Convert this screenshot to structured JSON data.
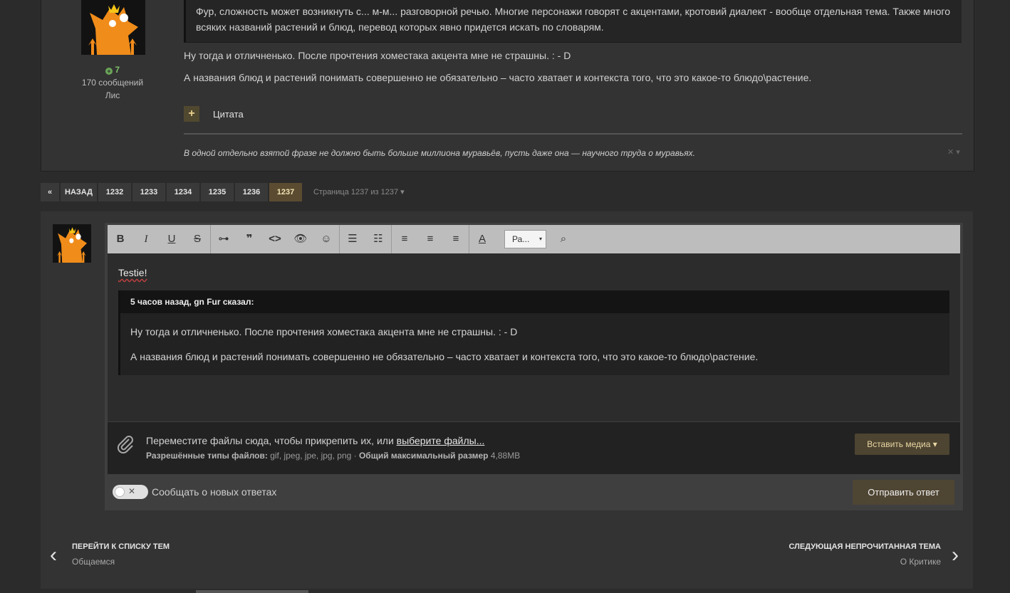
{
  "post": {
    "rep": "7",
    "posts_count": "170 сообщений",
    "member_title": "Лис",
    "quote_text": "Фур, сложность может возникнуть с... м-м... разговорной речью. Многие персонажи говорят с акцентами, кротовий диалект - вообще отдельная тема. Также много всяких названий растений и блюд, перевод которых явно придется искать по словарям.",
    "p1": "Ну тогда и отличненько. После прочтения хоместака акцента мне не страшны. : - D",
    "p2": "А названия блюд и растений понимать совершенно не обязательно – часто хватает и контекста того, что это какое-то блюдо\\растение.",
    "quote_plus": "+",
    "quote_label": "Цитата",
    "signature": "В одной отдельно взятой фразе не должно быть больше миллиона муравьёв, пусть даже она — научного труда о муравьях.",
    "sig_controls": "✕ ▾"
  },
  "pagination": {
    "first": "«",
    "prev": "НАЗАД",
    "pages": [
      "1232",
      "1233",
      "1234",
      "1235",
      "1236",
      "1237"
    ],
    "active": "1237",
    "info": "Страница 1237 из 1237 ▾"
  },
  "editor": {
    "toolbar": {
      "bold": "B",
      "italic": "I",
      "underline": "U",
      "strike": "S",
      "link": "⊶",
      "quote": "❞",
      "code": "<>",
      "spoiler": "👁",
      "emoji": "☺",
      "bullets": "☰",
      "numbers": "☷",
      "align_left": "≡",
      "align_center": "≡",
      "align_right": "≡",
      "color": "A",
      "font_select": "Ра...",
      "font_caret": "▾",
      "preview": "⌕"
    },
    "text": "Testie!",
    "quote_head": "5 часов назад, gn Fur сказал:",
    "quote_p1": "Ну тогда и отличненько. После прочтения хоместака акцента мне не страшны. : - D",
    "quote_p2": "А названия блюд и растений понимать совершенно не обязательно – часто хватает и контекста того, что это какое-то блюдо\\растение."
  },
  "attachments": {
    "drop_text": "Переместите файлы сюда, чтобы прикрепить их, или ",
    "choose_link": "выберите файлы...",
    "types_label": "Разрешённые типы файлов:",
    "types": " gif, jpeg, jpe, jpg, png · ",
    "max_label": "Общий максимальный размер",
    "max": " 4,88MB",
    "insert_media": "Вставить медиа ▾"
  },
  "notify": {
    "label": "Сообщать о новых ответах",
    "toggle_mark": "✕"
  },
  "submit": "Отправить ответ",
  "nav": {
    "back_title": "ПЕРЕЙТИ К СПИСКУ ТЕМ",
    "back_sub": "Общаемся",
    "next_title": "СЛЕДУЮЩАЯ НЕПРОЧИТАННАЯ ТЕМА",
    "next_sub": "О Критике",
    "left_arrow": "‹",
    "right_arrow": "›"
  }
}
